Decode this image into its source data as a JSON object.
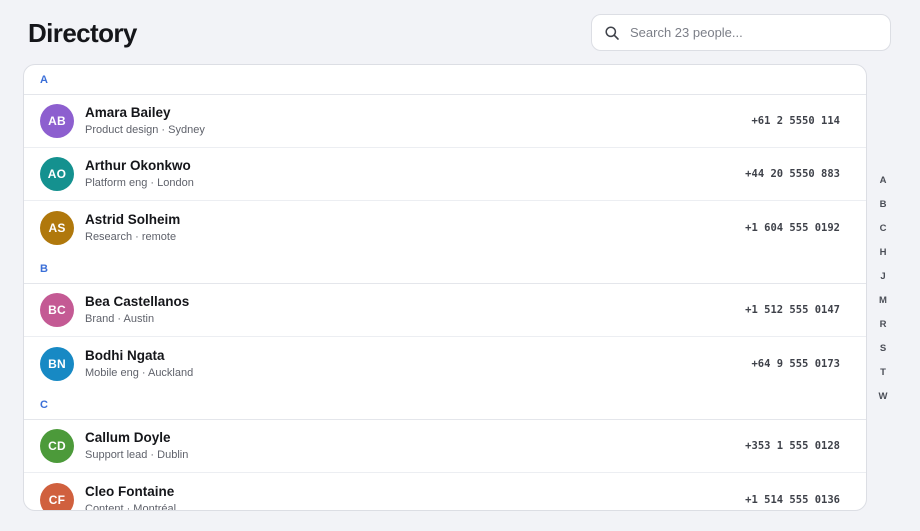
{
  "header": {
    "title": "Directory",
    "search_placeholder": "Search 23 people..."
  },
  "groups": [
    {
      "letter": "A",
      "people": [
        {
          "initials": "AB",
          "name": "Amara Bailey",
          "meta": "Product design · Sydney",
          "phone": "+61 2 5550 114",
          "color": "#8d5fcf"
        },
        {
          "initials": "AO",
          "name": "Arthur Okonkwo",
          "meta": "Platform eng · London",
          "phone": "+44 20 5550 883",
          "color": "#14918f"
        },
        {
          "initials": "AS",
          "name": "Astrid Solheim",
          "meta": "Research · remote",
          "phone": "+1 604 555 0192",
          "color": "#b0780c"
        }
      ]
    },
    {
      "letter": "B",
      "people": [
        {
          "initials": "BC",
          "name": "Bea Castellanos",
          "meta": "Brand · Austin",
          "phone": "+1 512 555 0147",
          "color": "#c45a94"
        },
        {
          "initials": "BN",
          "name": "Bodhi Ngata",
          "meta": "Mobile eng · Auckland",
          "phone": "+64 9 555 0173",
          "color": "#1789c4"
        }
      ]
    },
    {
      "letter": "C",
      "people": [
        {
          "initials": "CD",
          "name": "Callum Doyle",
          "meta": "Support lead · Dublin",
          "phone": "+353 1 555 0128",
          "color": "#4c9a3a"
        },
        {
          "initials": "CF",
          "name": "Cleo Fontaine",
          "meta": "Content · Montréal",
          "phone": "+1 514 555 0136",
          "color": "#d0603e"
        }
      ]
    }
  ],
  "az_index": [
    "A",
    "B",
    "C",
    "H",
    "J",
    "M",
    "R",
    "S",
    "T",
    "W"
  ]
}
